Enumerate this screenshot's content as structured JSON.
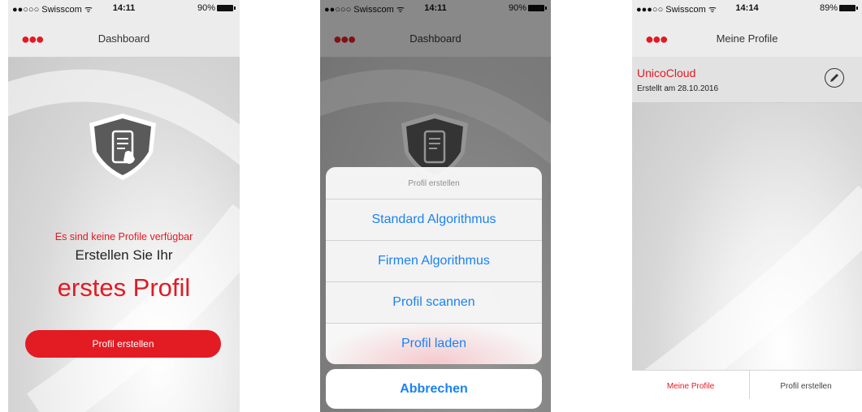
{
  "screens": [
    {
      "status": {
        "carrier": "●●○○○ Swisscom ᯤ",
        "time": "14:11",
        "battery": "90%"
      },
      "nav": {
        "menu": "●●●",
        "title": "Dashboard"
      },
      "empty_state": {
        "warning": "Es sind keine Profile verfügbar",
        "line1": "Erstellen Sie Ihr",
        "line2": "erstes Profil",
        "button": "Profil erstellen"
      }
    },
    {
      "status": {
        "carrier": "●●○○○ Swisscom ᯤ",
        "time": "14:11",
        "battery": "90%"
      },
      "nav": {
        "menu": "●●●",
        "title": "Dashboard"
      },
      "action_sheet": {
        "title": "Profil erstellen",
        "options": [
          "Standard Algorithmus",
          "Firmen Algorithmus",
          "Profil scannen",
          "Profil laden"
        ],
        "cancel": "Abbrechen"
      }
    },
    {
      "status": {
        "carrier": "●●●○○ Swisscom ᯤ",
        "time": "14:14",
        "battery": "89%"
      },
      "nav": {
        "menu": "●●●",
        "title": "Meine Profile"
      },
      "profiles": [
        {
          "name": "UnicoCloud",
          "created": "Erstellt am 28.10.2016"
        }
      ],
      "tabs": [
        "Meine Profile",
        "Profil erstellen"
      ]
    }
  ],
  "colors": {
    "accent_red": "#e01b24",
    "ios_blue": "#1a82f5"
  },
  "icons": {
    "menu": "three-dots-menu-icon",
    "shield": "shield-phone-icon",
    "edit": "pencil-edit-icon"
  }
}
